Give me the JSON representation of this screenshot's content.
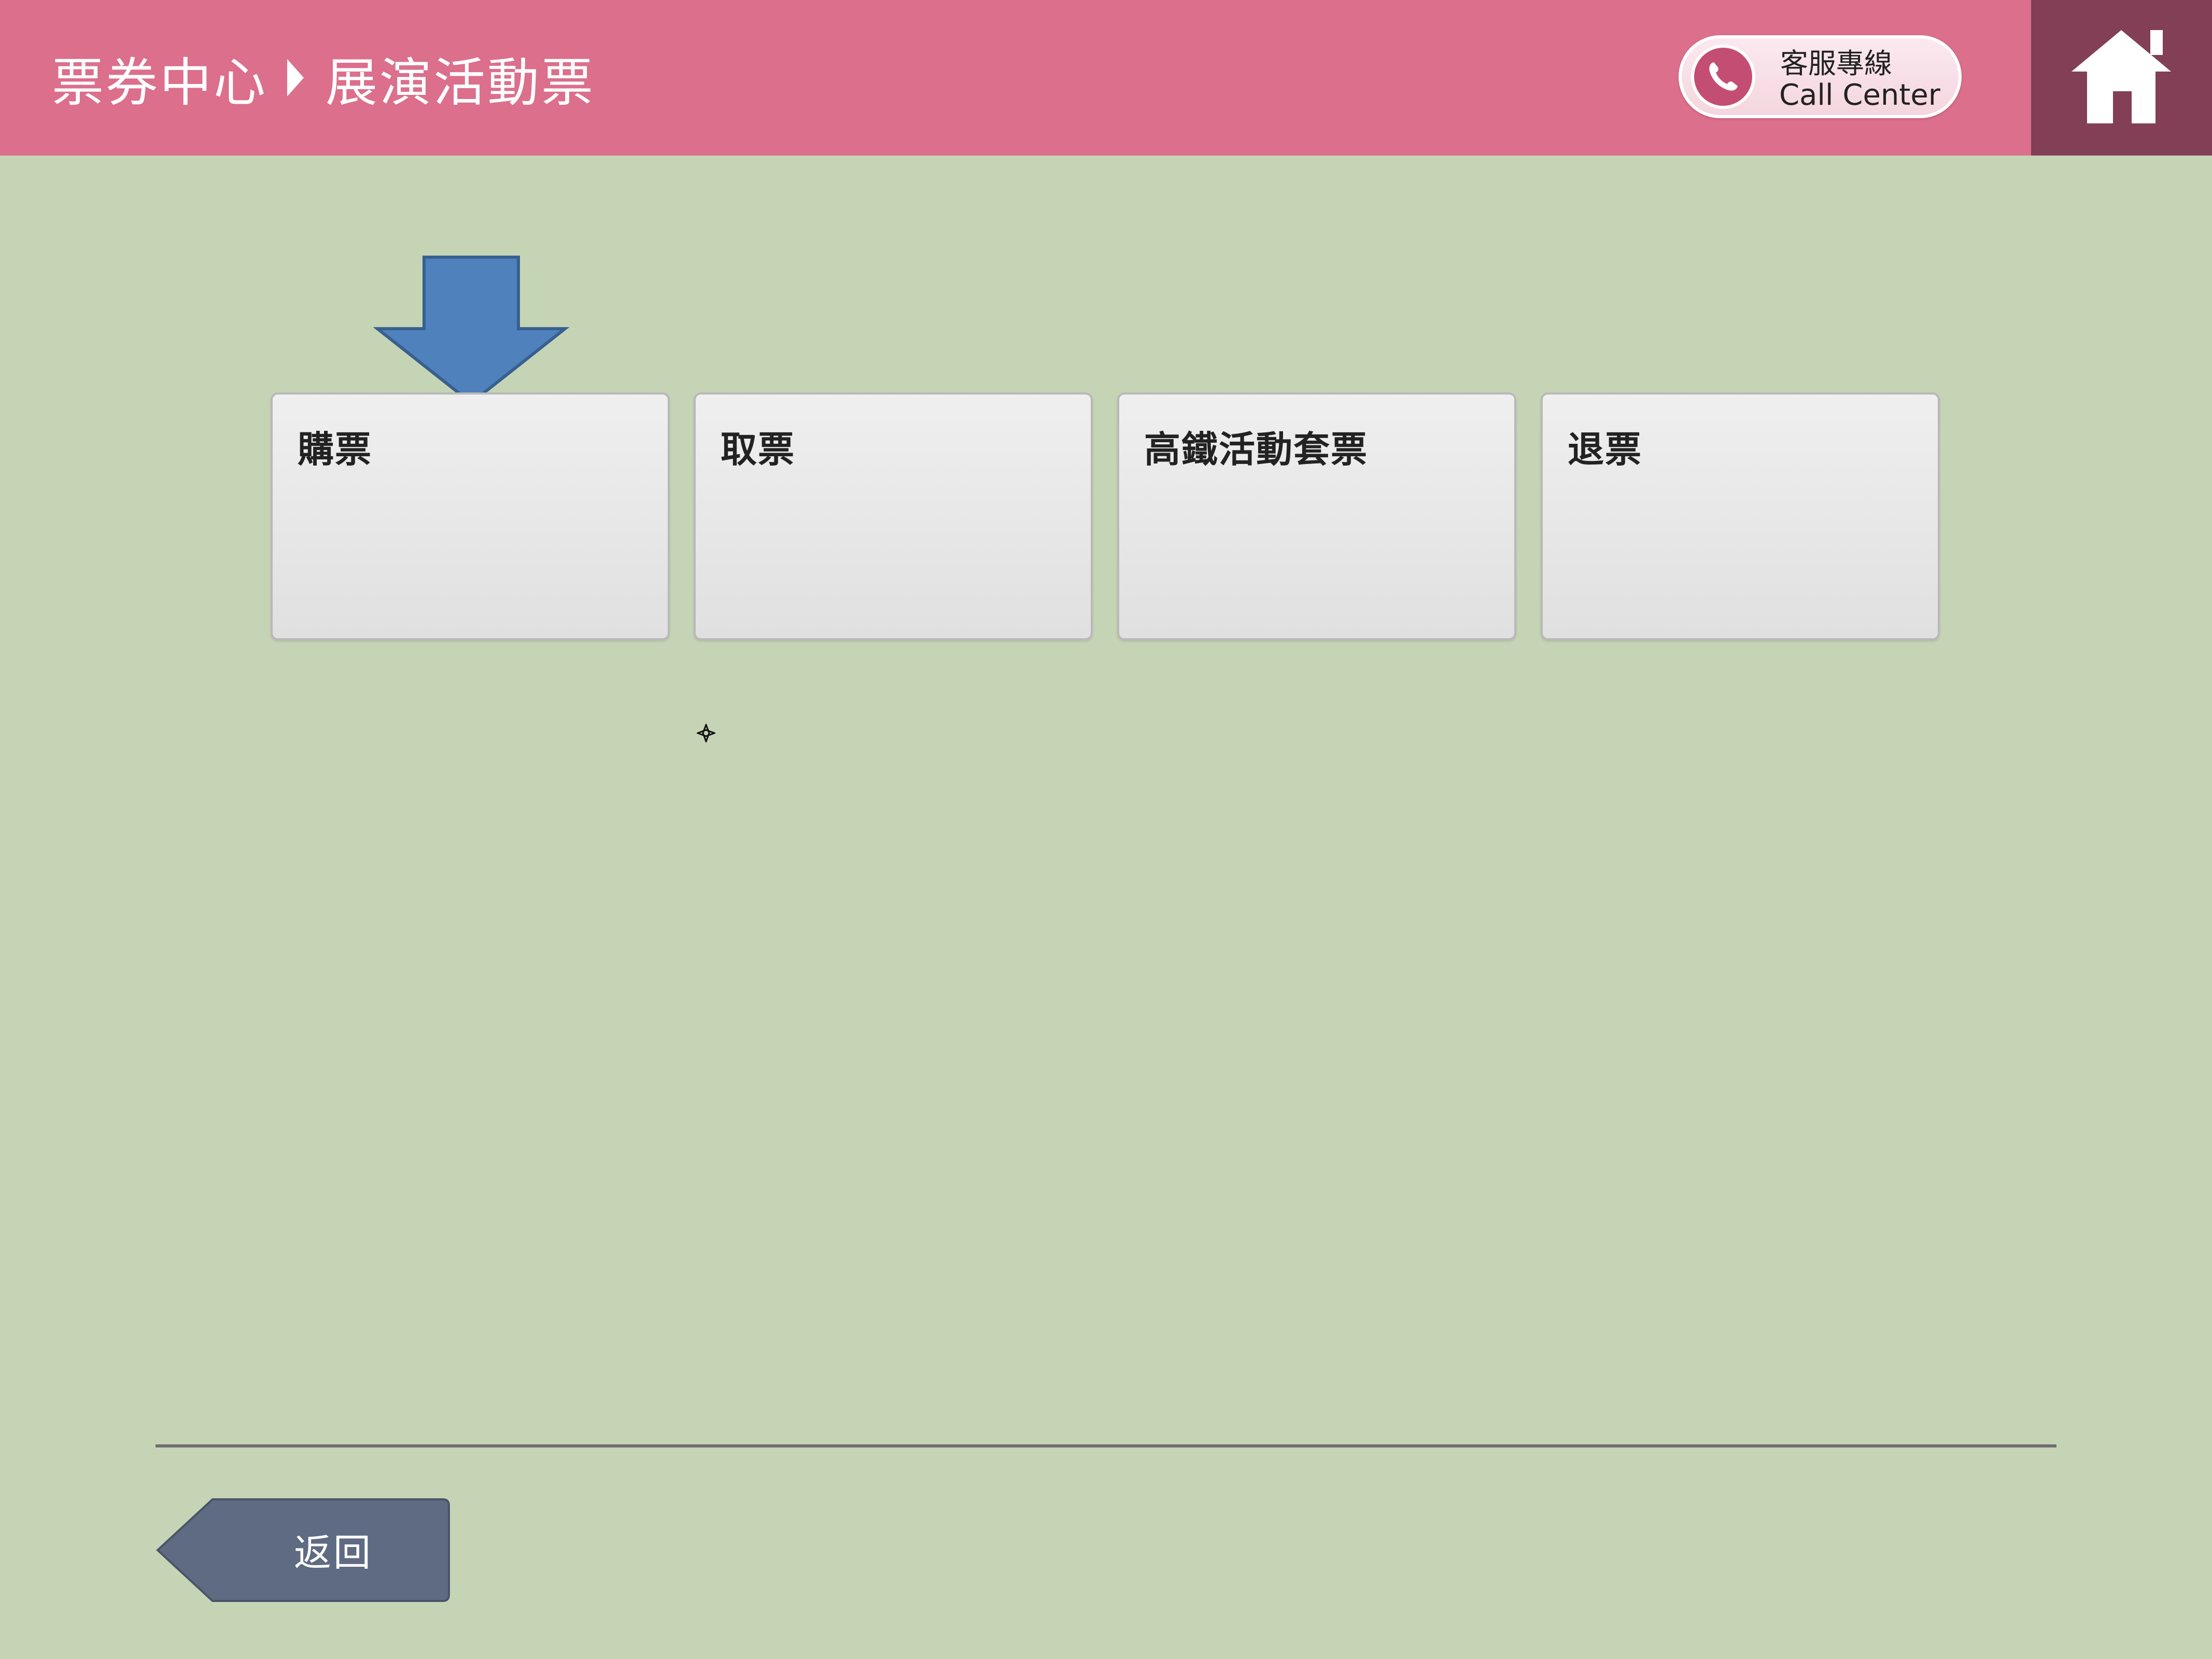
{
  "header": {
    "breadcrumb_root": "票券中心",
    "breadcrumb_current": "展演活動票",
    "call_center_zh": "客服專線",
    "call_center_en": "Call Center",
    "home_icon": "home-icon"
  },
  "tiles": [
    {
      "label": "購票"
    },
    {
      "label": "取票"
    },
    {
      "label": "高鐵活動套票"
    },
    {
      "label": "退票"
    }
  ],
  "footer": {
    "back_label": "返回"
  },
  "colors": {
    "header_bg": "#db6f8c",
    "home_bg": "#823f55",
    "page_bg": "#c6d4b6",
    "arrow": "#4f81bd",
    "back_button": "#5f6b82"
  }
}
